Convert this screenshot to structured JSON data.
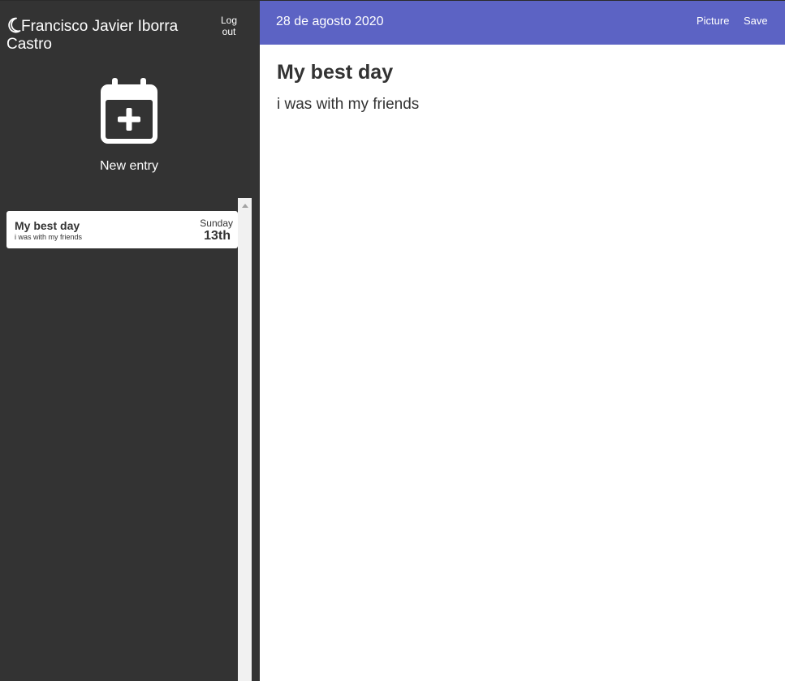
{
  "sidebar": {
    "user_name": "Francisco Javier Iborra Castro",
    "logout_label": "Log out",
    "new_entry_label": "New entry",
    "icons": {
      "moon": "moon-icon",
      "calendar_add": "calendar-plus-icon"
    },
    "entries": [
      {
        "title": "My best day",
        "snippet": "i was with my friends",
        "weekday": "Sunday",
        "day": "13th"
      }
    ]
  },
  "header": {
    "date": "28 de agosto 2020",
    "picture_label": "Picture",
    "save_label": "Save"
  },
  "editor": {
    "title": "My best day",
    "body": "i was with my friends"
  },
  "colors": {
    "sidebar_bg": "#333333",
    "topbar_bg": "#5c63c4",
    "text_dark": "#333333",
    "text_light": "#ffffff"
  }
}
